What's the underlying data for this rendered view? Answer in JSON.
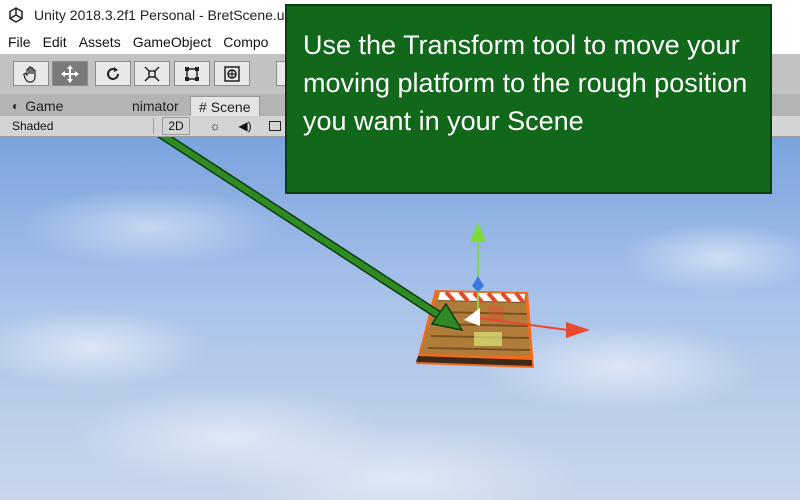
{
  "window": {
    "title": "Unity 2018.3.2f1 Personal - BretScene.u"
  },
  "menu": {
    "items": [
      "File",
      "Edit",
      "Assets",
      "GameObject",
      "Compo"
    ]
  },
  "toolbar": {
    "tools": [
      "hand-icon",
      "move-icon",
      "rotate-icon",
      "scale-icon",
      "rect-icon",
      "transform-icon"
    ],
    "active_index": 1
  },
  "tabs": {
    "game": "Game",
    "animator": "nimator",
    "scene": "Scene"
  },
  "scene_toolbar": {
    "shading": "Shaded",
    "mode_2d": "2D"
  },
  "callout": {
    "text": "Use the Transform tool to move your moving platform to the rough position you want in your Scene"
  },
  "colors": {
    "callout_bg": "#11681a",
    "arrow": "#1f6b1a",
    "selection": "#f26b1d",
    "gizmo_y": "#7ddc3a",
    "gizmo_x": "#e8492f",
    "gizmo_z": "#3a7be0"
  }
}
